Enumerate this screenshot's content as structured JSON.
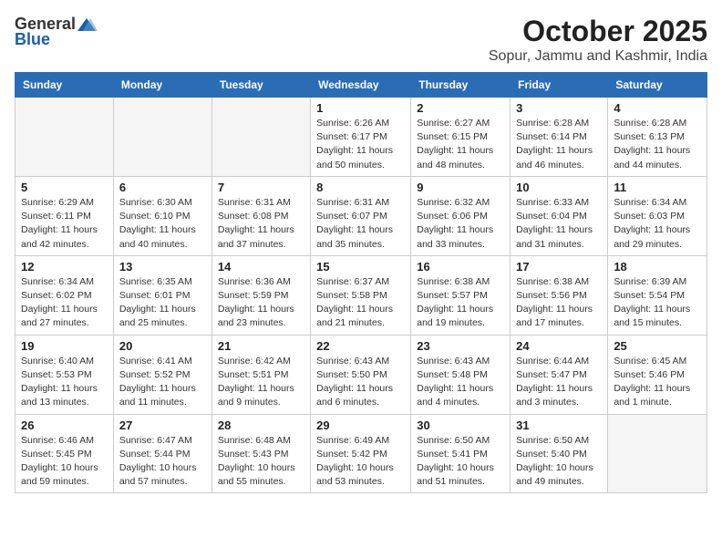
{
  "header": {
    "logo_general": "General",
    "logo_blue": "Blue",
    "month": "October 2025",
    "location": "Sopur, Jammu and Kashmir, India"
  },
  "weekdays": [
    "Sunday",
    "Monday",
    "Tuesday",
    "Wednesday",
    "Thursday",
    "Friday",
    "Saturday"
  ],
  "weeks": [
    [
      {
        "day": "",
        "info": ""
      },
      {
        "day": "",
        "info": ""
      },
      {
        "day": "",
        "info": ""
      },
      {
        "day": "1",
        "info": "Sunrise: 6:26 AM\nSunset: 6:17 PM\nDaylight: 11 hours\nand 50 minutes."
      },
      {
        "day": "2",
        "info": "Sunrise: 6:27 AM\nSunset: 6:15 PM\nDaylight: 11 hours\nand 48 minutes."
      },
      {
        "day": "3",
        "info": "Sunrise: 6:28 AM\nSunset: 6:14 PM\nDaylight: 11 hours\nand 46 minutes."
      },
      {
        "day": "4",
        "info": "Sunrise: 6:28 AM\nSunset: 6:13 PM\nDaylight: 11 hours\nand 44 minutes."
      }
    ],
    [
      {
        "day": "5",
        "info": "Sunrise: 6:29 AM\nSunset: 6:11 PM\nDaylight: 11 hours\nand 42 minutes."
      },
      {
        "day": "6",
        "info": "Sunrise: 6:30 AM\nSunset: 6:10 PM\nDaylight: 11 hours\nand 40 minutes."
      },
      {
        "day": "7",
        "info": "Sunrise: 6:31 AM\nSunset: 6:08 PM\nDaylight: 11 hours\nand 37 minutes."
      },
      {
        "day": "8",
        "info": "Sunrise: 6:31 AM\nSunset: 6:07 PM\nDaylight: 11 hours\nand 35 minutes."
      },
      {
        "day": "9",
        "info": "Sunrise: 6:32 AM\nSunset: 6:06 PM\nDaylight: 11 hours\nand 33 minutes."
      },
      {
        "day": "10",
        "info": "Sunrise: 6:33 AM\nSunset: 6:04 PM\nDaylight: 11 hours\nand 31 minutes."
      },
      {
        "day": "11",
        "info": "Sunrise: 6:34 AM\nSunset: 6:03 PM\nDaylight: 11 hours\nand 29 minutes."
      }
    ],
    [
      {
        "day": "12",
        "info": "Sunrise: 6:34 AM\nSunset: 6:02 PM\nDaylight: 11 hours\nand 27 minutes."
      },
      {
        "day": "13",
        "info": "Sunrise: 6:35 AM\nSunset: 6:01 PM\nDaylight: 11 hours\nand 25 minutes."
      },
      {
        "day": "14",
        "info": "Sunrise: 6:36 AM\nSunset: 5:59 PM\nDaylight: 11 hours\nand 23 minutes."
      },
      {
        "day": "15",
        "info": "Sunrise: 6:37 AM\nSunset: 5:58 PM\nDaylight: 11 hours\nand 21 minutes."
      },
      {
        "day": "16",
        "info": "Sunrise: 6:38 AM\nSunset: 5:57 PM\nDaylight: 11 hours\nand 19 minutes."
      },
      {
        "day": "17",
        "info": "Sunrise: 6:38 AM\nSunset: 5:56 PM\nDaylight: 11 hours\nand 17 minutes."
      },
      {
        "day": "18",
        "info": "Sunrise: 6:39 AM\nSunset: 5:54 PM\nDaylight: 11 hours\nand 15 minutes."
      }
    ],
    [
      {
        "day": "19",
        "info": "Sunrise: 6:40 AM\nSunset: 5:53 PM\nDaylight: 11 hours\nand 13 minutes."
      },
      {
        "day": "20",
        "info": "Sunrise: 6:41 AM\nSunset: 5:52 PM\nDaylight: 11 hours\nand 11 minutes."
      },
      {
        "day": "21",
        "info": "Sunrise: 6:42 AM\nSunset: 5:51 PM\nDaylight: 11 hours\nand 9 minutes."
      },
      {
        "day": "22",
        "info": "Sunrise: 6:43 AM\nSunset: 5:50 PM\nDaylight: 11 hours\nand 6 minutes."
      },
      {
        "day": "23",
        "info": "Sunrise: 6:43 AM\nSunset: 5:48 PM\nDaylight: 11 hours\nand 4 minutes."
      },
      {
        "day": "24",
        "info": "Sunrise: 6:44 AM\nSunset: 5:47 PM\nDaylight: 11 hours\nand 3 minutes."
      },
      {
        "day": "25",
        "info": "Sunrise: 6:45 AM\nSunset: 5:46 PM\nDaylight: 11 hours\nand 1 minute."
      }
    ],
    [
      {
        "day": "26",
        "info": "Sunrise: 6:46 AM\nSunset: 5:45 PM\nDaylight: 10 hours\nand 59 minutes."
      },
      {
        "day": "27",
        "info": "Sunrise: 6:47 AM\nSunset: 5:44 PM\nDaylight: 10 hours\nand 57 minutes."
      },
      {
        "day": "28",
        "info": "Sunrise: 6:48 AM\nSunset: 5:43 PM\nDaylight: 10 hours\nand 55 minutes."
      },
      {
        "day": "29",
        "info": "Sunrise: 6:49 AM\nSunset: 5:42 PM\nDaylight: 10 hours\nand 53 minutes."
      },
      {
        "day": "30",
        "info": "Sunrise: 6:50 AM\nSunset: 5:41 PM\nDaylight: 10 hours\nand 51 minutes."
      },
      {
        "day": "31",
        "info": "Sunrise: 6:50 AM\nSunset: 5:40 PM\nDaylight: 10 hours\nand 49 minutes."
      },
      {
        "day": "",
        "info": ""
      }
    ]
  ]
}
